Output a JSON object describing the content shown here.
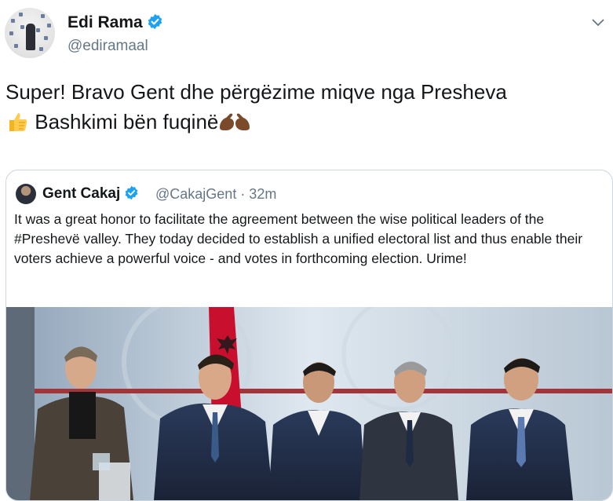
{
  "author": {
    "name": "Edi Rama",
    "handle": "@ediramaal"
  },
  "tweet": {
    "text_line1": "Super! Bravo Gent dhe përgëzime miqve nga Presheva",
    "text_line2": "Bashkimi bën fuqinë"
  },
  "quote": {
    "name": "Gent Cakaj",
    "handle": "@CakajGent · 32m",
    "text": "It was a great honor to facilitate the agreement between the wise political leaders of the #Preshevë valley. They today decided to establish a unified electoral list and thus enable their voters achieve a powerful voice - and votes in forthcoming election. Urime!"
  },
  "icons": {
    "verified": "verified-badge-icon",
    "caret": "chevron-down-icon",
    "thumbs_up": "thumbs-up-emoji",
    "muscles": "flexed-biceps-emoji"
  },
  "colors": {
    "verified_blue": "#1da1f2",
    "secondary_text": "#657786",
    "border": "#ccd6dd",
    "flag_red": "#c8102e"
  }
}
